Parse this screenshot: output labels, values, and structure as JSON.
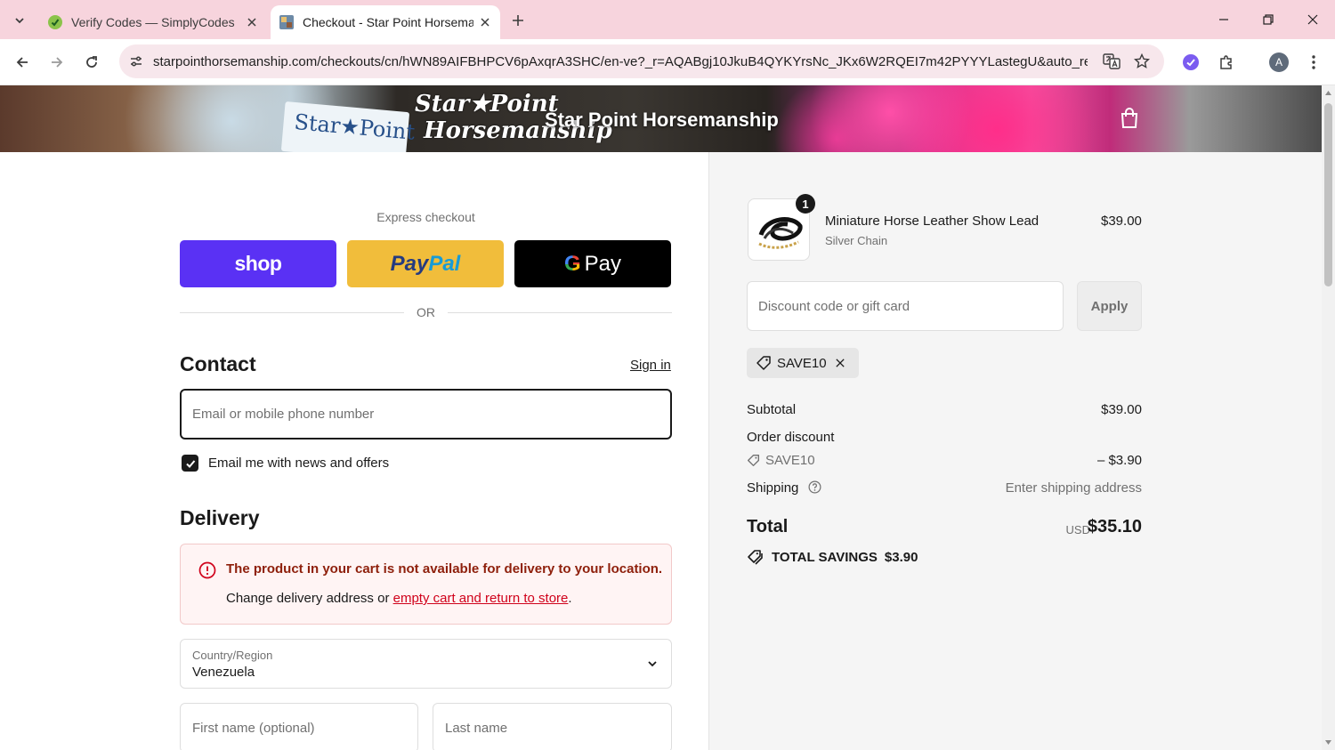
{
  "browser": {
    "tabs": [
      {
        "title": "Verify Codes — SimplyCodes",
        "active": false,
        "favicon": "simplycodes-favicon"
      },
      {
        "title": "Checkout - Star Point Horsemanship",
        "active": true,
        "favicon": "store-favicon"
      }
    ],
    "url": "starpointhorsemanship.com/checkouts/cn/hWN89AIFBHPCV6pAxqrA3SHC/en-ve?_r=AQABgj10JkuB4QYKYrsNc_JKx6W2RQEI7m42PYYYLastegU&auto_re...",
    "profile_initial": "A",
    "colors": {
      "tab_strip": "#f7d4dd",
      "omnibox": "#f7e7ec"
    }
  },
  "header": {
    "logo_text_line1": "Star★Point",
    "logo_text_line2": "Horsemanship",
    "store_name": "Star Point Horsemanship",
    "card_text": "Star★Point"
  },
  "checkout": {
    "express_label": "Express checkout",
    "shop_label": "shop",
    "paypal_part1": "Pay",
    "paypal_part2": "Pal",
    "gpay_g": "G",
    "gpay_label": "Pay",
    "or_label": "OR",
    "contact_heading": "Contact",
    "sign_in": "Sign in",
    "email_placeholder": "Email or mobile phone number",
    "email_value": "",
    "newsletter_label": "Email me with news and offers",
    "newsletter_checked": true,
    "delivery_heading": "Delivery",
    "alert_title": "The product in your cart is not available for delivery to your location.",
    "alert_prefix": "Change delivery address or ",
    "alert_link": "empty cart and return to store",
    "alert_suffix": ".",
    "country_label": "Country/Region",
    "country_value": "Venezuela",
    "first_name_placeholder": "First name (optional)",
    "last_name_placeholder": "Last name"
  },
  "summary": {
    "item": {
      "quantity": "1",
      "name": "Miniature Horse Leather Show Lead",
      "variant": "Silver Chain",
      "price": "$39.00"
    },
    "discount_placeholder": "Discount code or gift card",
    "apply_label": "Apply",
    "applied_code": "SAVE10",
    "subtotal_label": "Subtotal",
    "subtotal_value": "$39.00",
    "order_discount_label": "Order discount",
    "discount_code": "SAVE10",
    "discount_value": "– $3.90",
    "shipping_label": "Shipping",
    "shipping_value": "Enter shipping address",
    "total_label": "Total",
    "currency": "USD",
    "total_value": "$35.10",
    "savings_label": "TOTAL SAVINGS",
    "savings_value": "$3.90"
  }
}
